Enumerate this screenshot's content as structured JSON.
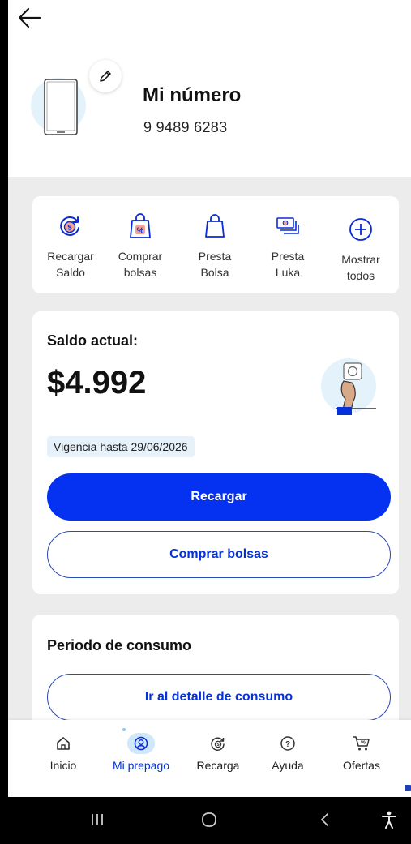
{
  "header": {
    "number_title": "Mi número",
    "number_value": "9 9489 6283"
  },
  "actions": [
    {
      "label_line1": "Recargar",
      "label_line2": "Saldo",
      "icon": "recharge-coin-icon"
    },
    {
      "label_line1": "Comprar",
      "label_line2": "bolsas",
      "icon": "shopping-bag-percent-icon"
    },
    {
      "label_line1": "Presta",
      "label_line2": "Bolsa",
      "icon": "bag-icon"
    },
    {
      "label_line1": "Presta",
      "label_line2": "Luka",
      "icon": "cash-stack-icon"
    },
    {
      "label_line1": "Mostrar",
      "label_line2": "todos",
      "icon": "plus-circle-icon"
    }
  ],
  "balance": {
    "title": "Saldo actual:",
    "amount": "$4.992",
    "validity": "Vigencia hasta 29/06/2026",
    "primary_button": "Recargar",
    "secondary_button": "Comprar bolsas"
  },
  "consumption": {
    "title": "Periodo de consumo",
    "button": "Ir al detalle de consumo"
  },
  "bottom_nav": [
    {
      "label": "Inicio",
      "icon": "home-icon",
      "active": false
    },
    {
      "label": "Mi prepago",
      "icon": "prepaid-user-icon",
      "active": true
    },
    {
      "label": "Recarga",
      "icon": "recharge-icon",
      "active": false
    },
    {
      "label": "Ayuda",
      "icon": "help-icon",
      "active": false
    },
    {
      "label": "Ofertas",
      "icon": "offers-cart-icon",
      "active": false
    }
  ],
  "colors": {
    "accent": "#0532f0",
    "link_blue": "#0532d8",
    "page_bg": "#ececec",
    "badge_bg": "#e6f1fa"
  }
}
